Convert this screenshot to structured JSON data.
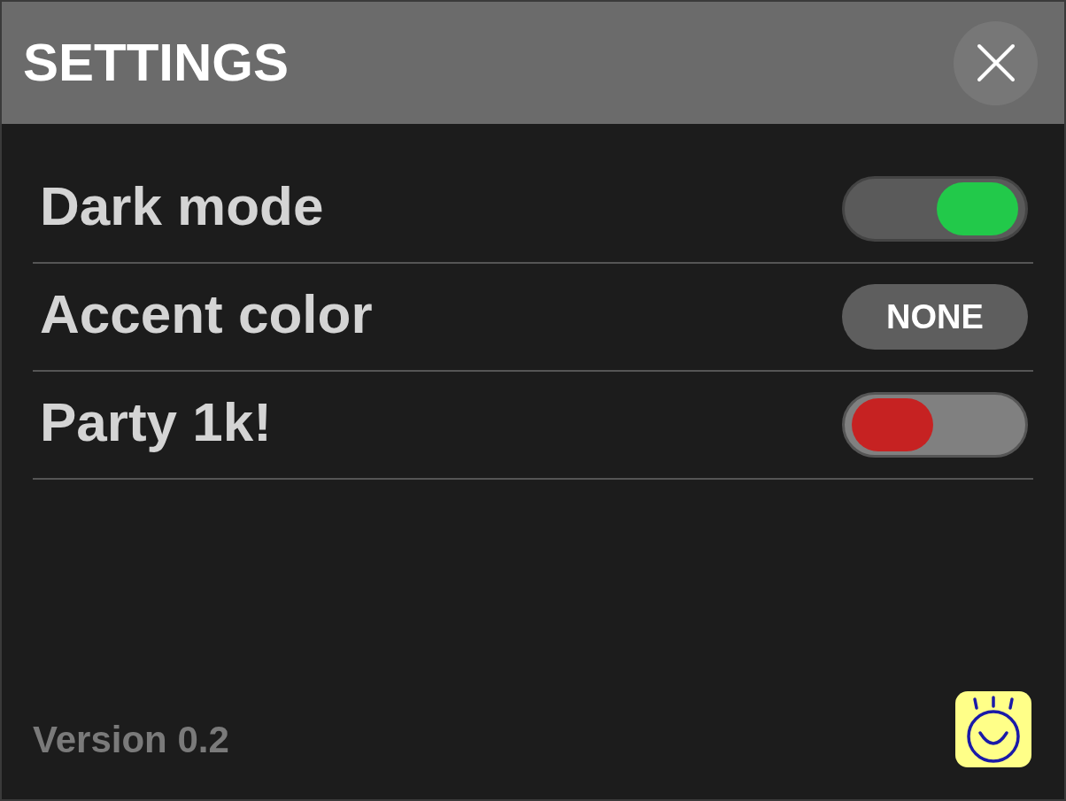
{
  "header": {
    "title": "SETTINGS"
  },
  "settings": [
    {
      "kind": "toggle",
      "label": "Dark mode",
      "on": true
    },
    {
      "kind": "choice",
      "label": "Accent color",
      "value": "NONE"
    },
    {
      "kind": "toggle",
      "label": "Party 1k!",
      "on": false
    }
  ],
  "footer": {
    "version": "Version 0.2"
  }
}
